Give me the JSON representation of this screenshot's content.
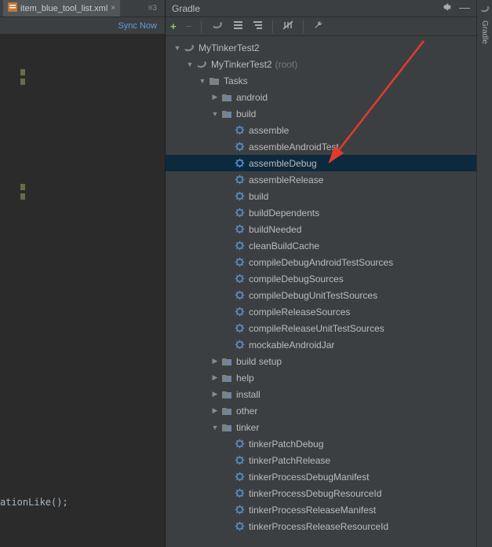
{
  "editor": {
    "tab_filename": "item_blue_tool_list.xml",
    "tab_meta": "≡3",
    "sync_now": "Sync Now",
    "code_fragment": "ationLike();"
  },
  "gradle": {
    "title": "Gradle",
    "root": {
      "label": "MyTinkerTest2"
    },
    "project": {
      "label": "MyTinkerTest2",
      "suffix": "(root)"
    },
    "tasks": {
      "label": "Tasks"
    },
    "groups": {
      "android": "android",
      "build": "build",
      "build_setup": "build setup",
      "help": "help",
      "install": "install",
      "other": "other",
      "tinker": "tinker"
    },
    "build_tasks": [
      "assemble",
      "assembleAndroidTest",
      "assembleDebug",
      "assembleRelease",
      "build",
      "buildDependents",
      "buildNeeded",
      "cleanBuildCache",
      "compileDebugAndroidTestSources",
      "compileDebugSources",
      "compileDebugUnitTestSources",
      "compileReleaseSources",
      "compileReleaseUnitTestSources",
      "mockableAndroidJar"
    ],
    "tinker_tasks": [
      "tinkerPatchDebug",
      "tinkerPatchRelease",
      "tinkerProcessDebugManifest",
      "tinkerProcessDebugResourceId",
      "tinkerProcessReleaseManifest",
      "tinkerProcessReleaseResourceId"
    ]
  },
  "sidebar": {
    "gradle_tab": "Gradle"
  }
}
